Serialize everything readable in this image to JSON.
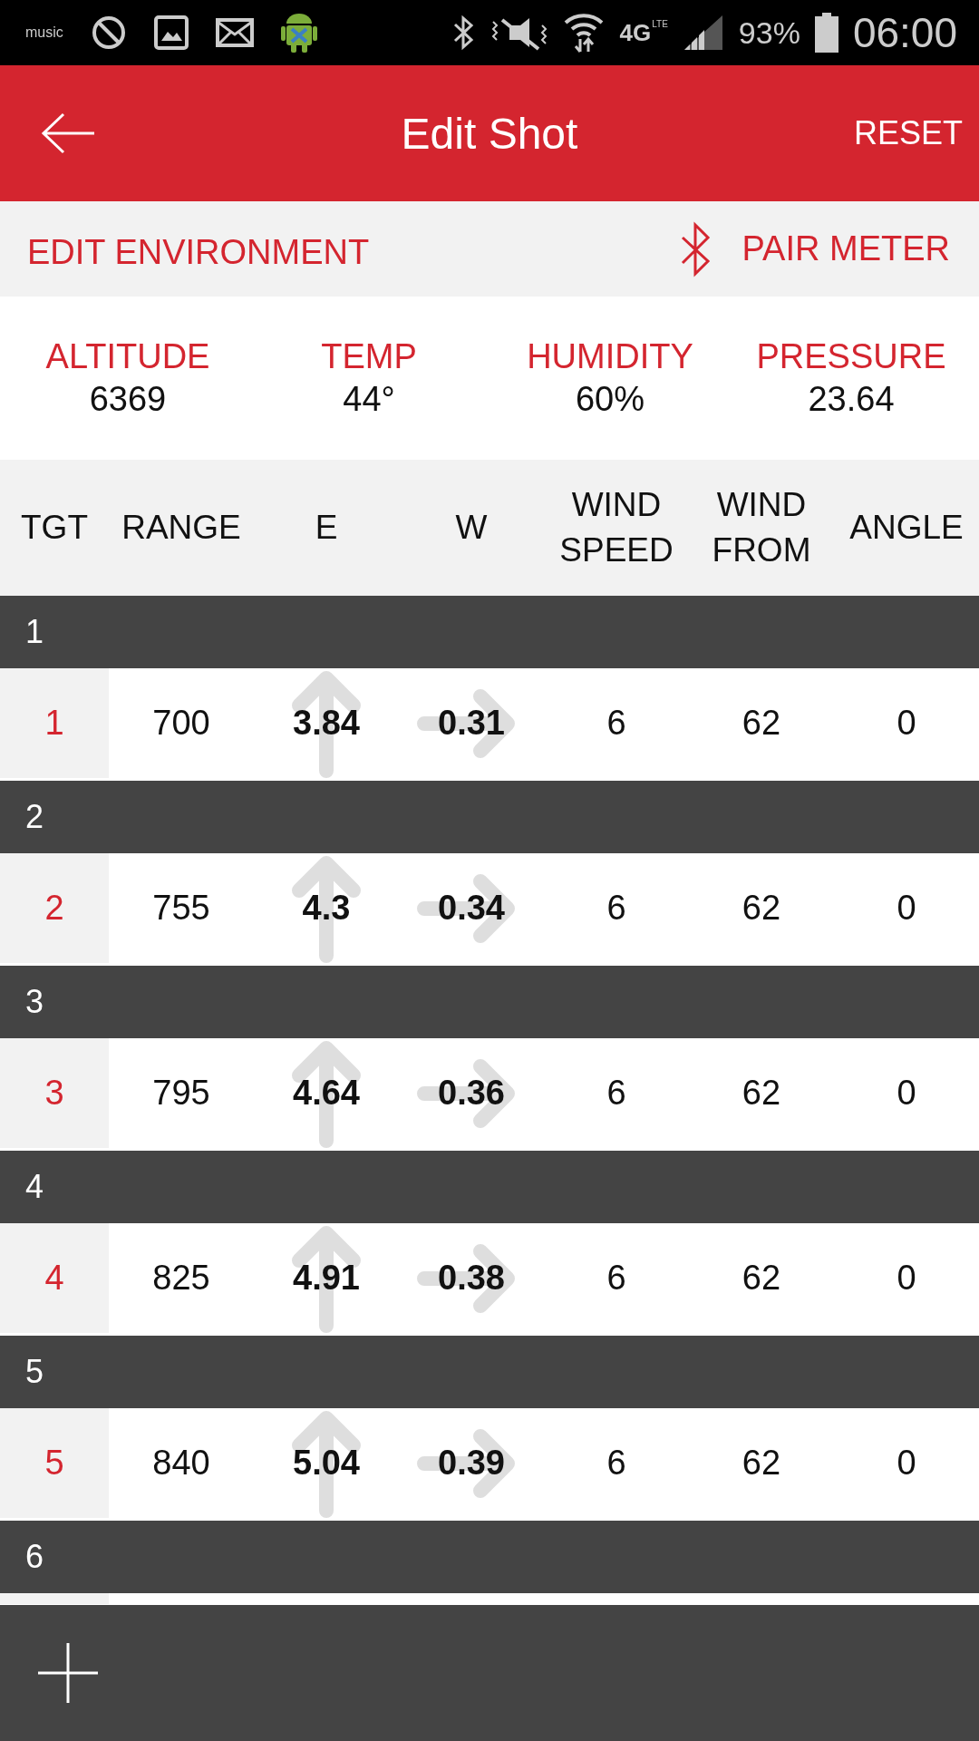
{
  "status_bar": {
    "music_label": "music",
    "network_label": "4G",
    "network_sub": "LTE",
    "battery": "93%",
    "time": "06:00"
  },
  "app_bar": {
    "title": "Edit Shot",
    "action": "RESET"
  },
  "environment": {
    "title": "EDIT ENVIRONMENT",
    "pair_button": "PAIR METER",
    "fields": [
      {
        "label": "ALTITUDE",
        "value": "6369"
      },
      {
        "label": "TEMP",
        "value": "44°"
      },
      {
        "label": "HUMIDITY",
        "value": "60%"
      },
      {
        "label": "PRESSURE",
        "value": "23.64"
      }
    ]
  },
  "table": {
    "columns": [
      "TGT",
      "RANGE",
      "E",
      "W",
      "WIND SPEED",
      "WIND FROM",
      "ANGLE"
    ],
    "groups": [
      {
        "label": "1",
        "rows": [
          {
            "tgt": "1",
            "range": "700",
            "e": "3.84",
            "w": "0.31",
            "wind_speed": "6",
            "wind_from": "62",
            "angle": "0"
          }
        ]
      },
      {
        "label": "2",
        "rows": [
          {
            "tgt": "2",
            "range": "755",
            "e": "4.3",
            "w": "0.34",
            "wind_speed": "6",
            "wind_from": "62",
            "angle": "0"
          }
        ]
      },
      {
        "label": "3",
        "rows": [
          {
            "tgt": "3",
            "range": "795",
            "e": "4.64",
            "w": "0.36",
            "wind_speed": "6",
            "wind_from": "62",
            "angle": "0"
          }
        ]
      },
      {
        "label": "4",
        "rows": [
          {
            "tgt": "4",
            "range": "825",
            "e": "4.91",
            "w": "0.38",
            "wind_speed": "6",
            "wind_from": "62",
            "angle": "0"
          }
        ]
      },
      {
        "label": "5",
        "rows": [
          {
            "tgt": "5",
            "range": "840",
            "e": "5.04",
            "w": "0.39",
            "wind_speed": "6",
            "wind_from": "62",
            "angle": "0"
          }
        ]
      },
      {
        "label": "6"
      }
    ]
  }
}
